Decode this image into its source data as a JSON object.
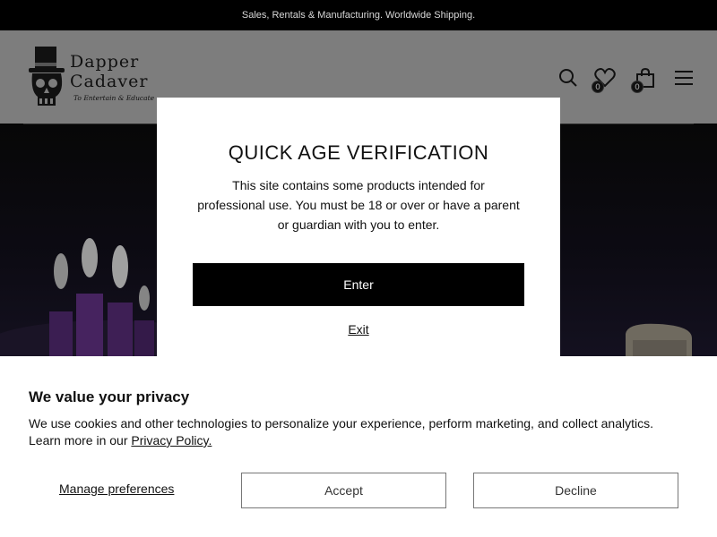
{
  "announcement": {
    "text": "Sales, Rentals & Manufacturing. Worldwide Shipping."
  },
  "header": {
    "logo": {
      "line1": "Dapper",
      "line2": "Cadaver",
      "tagline": "To Entertain & Educate"
    },
    "icons": {
      "search": "search-icon",
      "wishlist": "heart-icon",
      "cart": "shopping-bag-icon",
      "menu": "hamburger-menu-icon"
    },
    "wishlist_count": "0",
    "cart_count": "0"
  },
  "age_modal": {
    "title": "QUICK AGE VERIFICATION",
    "body": "This site contains some products intended for professional use. You must be 18 or over or have a parent or guardian with you to enter.",
    "enter_label": "Enter",
    "exit_label": "Exit"
  },
  "cookie_banner": {
    "title": "We value your privacy",
    "text": "We use cookies and other technologies to personalize your experience, perform marketing, and collect analytics. Learn more in our",
    "policy_link": "Privacy Policy.",
    "manage_label": "Manage preferences",
    "accept_label": "Accept",
    "decline_label": "Decline"
  },
  "colors": {
    "accent": "#000000",
    "overlay": "#7d7d7d",
    "candle_wax": "#5a2a7a"
  }
}
